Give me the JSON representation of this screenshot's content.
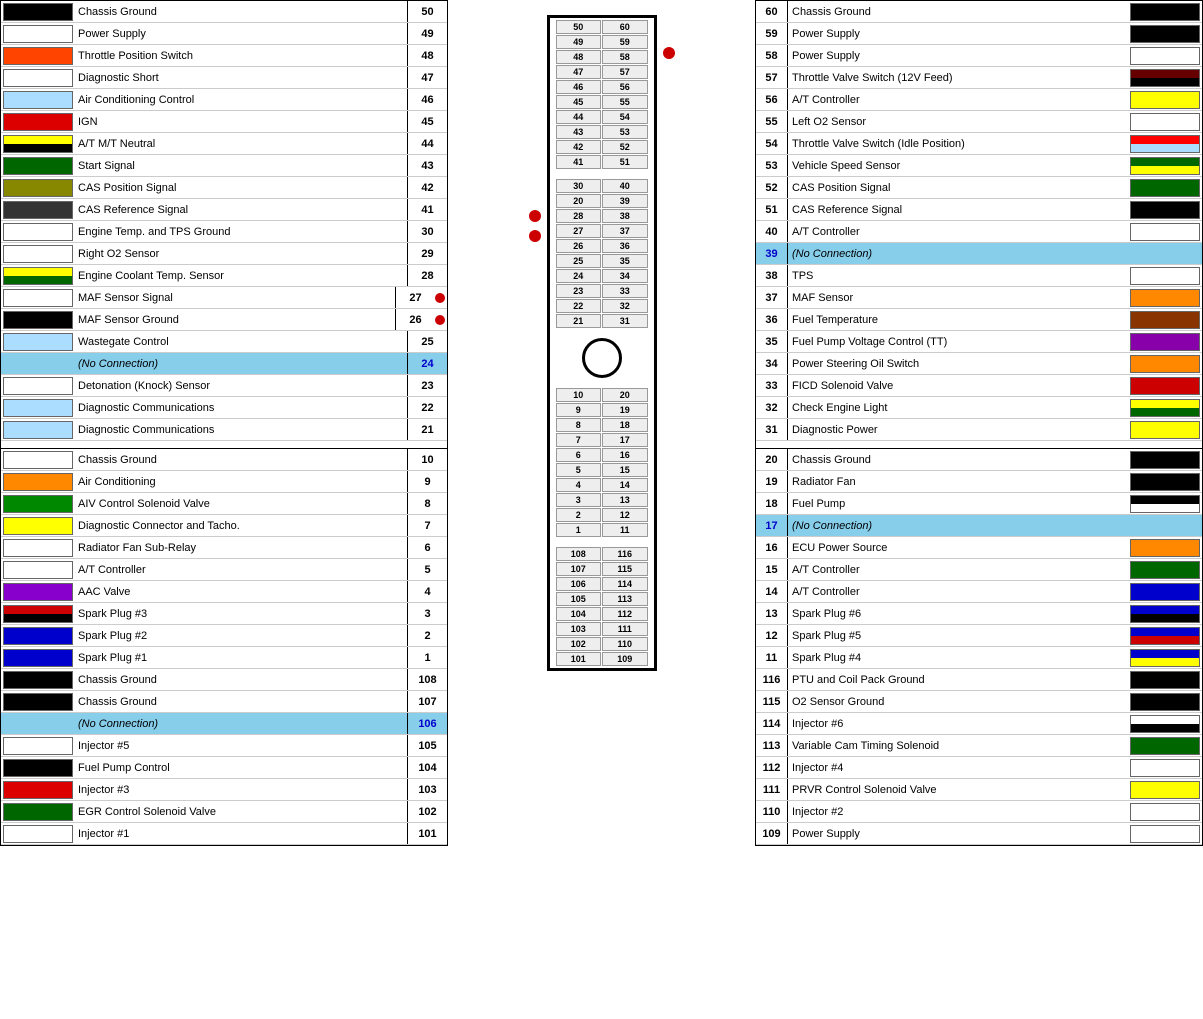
{
  "left": {
    "rows_top": [
      {
        "num": 50,
        "label": "Chassis Ground",
        "color": "#000000",
        "color2": null
      },
      {
        "num": 49,
        "label": "Power Supply",
        "color": "#ffffff",
        "color2": null
      },
      {
        "num": 48,
        "label": "Throttle Position Switch",
        "color": "#ff4400",
        "color2": null,
        "stripe": "#000000"
      },
      {
        "num": 47,
        "label": "Diagnostic Short",
        "color": "#ffffff",
        "color2": null
      },
      {
        "num": 46,
        "label": "Air Conditioning Control",
        "color": "#aaddff",
        "color2": null
      },
      {
        "num": 45,
        "label": "IGN",
        "color": "#dd0000",
        "color2": null
      },
      {
        "num": 44,
        "label": "A/T M/T Neutral",
        "color": "#ffff00",
        "color2": "#000000"
      },
      {
        "num": 43,
        "label": "Start Signal",
        "color": "#006600",
        "color2": null
      },
      {
        "num": 42,
        "label": "CAS Position Signal",
        "color": "#888800",
        "color2": null
      },
      {
        "num": 41,
        "label": "CAS Reference Signal",
        "color": "#333333",
        "color2": null
      },
      {
        "num": 30,
        "label": "Engine Temp. and TPS Ground",
        "color": "#ffffff",
        "color2": null
      },
      {
        "num": 29,
        "label": "Right O2 Sensor",
        "color": "#ffffff",
        "color2": null
      },
      {
        "num": 28,
        "label": "Engine Coolant Temp. Sensor",
        "color": "#ffff00",
        "color2": "#006600"
      },
      {
        "num": 27,
        "label": "MAF Sensor Signal",
        "color": "#ffffff",
        "color2": null,
        "dot": true
      },
      {
        "num": 26,
        "label": "MAF Sensor Ground",
        "color": "#000000",
        "color2": null,
        "dot": true
      },
      {
        "num": 25,
        "label": "Wastegate Control",
        "color": "#aaddff",
        "color2": null
      },
      {
        "num": 24,
        "label": "(No Connection)",
        "color": null,
        "color2": null,
        "no_conn": true
      },
      {
        "num": 23,
        "label": "Detonation (Knock) Sensor",
        "color": "#ffffff",
        "color2": null
      },
      {
        "num": 22,
        "label": "Diagnostic Communications",
        "color": "#aaddff",
        "color2": null
      },
      {
        "num": 21,
        "label": "Diagnostic Communications",
        "color": "#aaddff",
        "color2": null
      }
    ],
    "rows_bottom": [
      {
        "num": 10,
        "label": "Chassis Ground",
        "color": "#ffffff",
        "color2": null
      },
      {
        "num": 9,
        "label": "Air Conditioning",
        "color": "#ff8800",
        "color2": null
      },
      {
        "num": 8,
        "label": "AIV Control Solenoid Valve",
        "color": "#008800",
        "color2": null
      },
      {
        "num": 7,
        "label": "Diagnostic Connector and Tacho.",
        "color": "#ffff00",
        "color2": null
      },
      {
        "num": 6,
        "label": "Radiator Fan Sub-Relay",
        "color": "#ffffff",
        "color2": null
      },
      {
        "num": 5,
        "label": "A/T Controller",
        "color": "#ffffff",
        "color2": null
      },
      {
        "num": 4,
        "label": "AAC Valve",
        "color": "#8800cc",
        "color2": null
      },
      {
        "num": 3,
        "label": "Spark Plug #3",
        "color": "#cc0000",
        "color2": "#000000"
      },
      {
        "num": 2,
        "label": "Spark Plug #2",
        "color": "#0000cc",
        "color2": null
      },
      {
        "num": 1,
        "label": "Spark Plug #1",
        "color": "#0000cc",
        "color2": null
      },
      {
        "num": 108,
        "label": "Chassis Ground",
        "color": "#000000",
        "color2": null
      },
      {
        "num": 107,
        "label": "Chassis Ground",
        "color": "#000000",
        "color2": null
      },
      {
        "num": 106,
        "label": "(No Connection)",
        "color": null,
        "color2": null,
        "no_conn": true
      },
      {
        "num": 105,
        "label": "Injector #5",
        "color": "#ffffff",
        "color2": null
      },
      {
        "num": 104,
        "label": "Fuel Pump Control",
        "color": "#000000",
        "color2": null
      },
      {
        "num": 103,
        "label": "Injector #3",
        "color": "#dd0000",
        "color2": null
      },
      {
        "num": 102,
        "label": "EGR Control Solenoid Valve",
        "color": "#006600",
        "color2": null
      },
      {
        "num": 101,
        "label": "Injector #1",
        "color": "#ffffff",
        "color2": null
      }
    ]
  },
  "right": {
    "rows_top": [
      {
        "num": 60,
        "label": "Chassis Ground",
        "color": "#000000",
        "color2": null
      },
      {
        "num": 59,
        "label": "Power Supply",
        "color": "#000000",
        "color2": null
      },
      {
        "num": 58,
        "label": "Power Supply",
        "color": "#ffffff",
        "color2": null
      },
      {
        "num": 57,
        "label": "Throttle Valve Switch (12V Feed)",
        "color": "#660000",
        "color2": "#000000"
      },
      {
        "num": 56,
        "label": "A/T Controller",
        "color": "#ffff00",
        "color2": null
      },
      {
        "num": 55,
        "label": "Left O2 Sensor",
        "color": "#ffffff",
        "color2": null
      },
      {
        "num": 54,
        "label": "Throttle Valve Switch (Idle Position)",
        "color": "#ff0000",
        "color2": "#aaddff"
      },
      {
        "num": 53,
        "label": "Vehicle Speed Sensor",
        "color": "#006600",
        "color2": "#ffff00"
      },
      {
        "num": 52,
        "label": "CAS Position Signal",
        "color": "#006600",
        "color2": null
      },
      {
        "num": 51,
        "label": "CAS Reference Signal",
        "color": "#000000",
        "color2": null
      },
      {
        "num": 40,
        "label": "A/T Controller",
        "color": "#ffffff",
        "color2": null
      },
      {
        "num": 39,
        "label": "(No Connection)",
        "color": null,
        "color2": null,
        "no_conn": true
      },
      {
        "num": 38,
        "label": "TPS",
        "color": "#ffffff",
        "color2": null
      },
      {
        "num": 37,
        "label": "MAF Sensor",
        "color": "#ff8800",
        "color2": null
      },
      {
        "num": 36,
        "label": "Fuel Temperature",
        "color": "#883300",
        "color2": null
      },
      {
        "num": 35,
        "label": "Fuel Pump Voltage Control (TT)",
        "color": "#8800aa",
        "color2": null
      },
      {
        "num": 34,
        "label": "Power Steering Oil Switch",
        "color": "#ff8800",
        "color2": null
      },
      {
        "num": 33,
        "label": "FICD Solenoid Valve",
        "color": "#cc0000",
        "color2": null
      },
      {
        "num": 32,
        "label": "Check Engine Light",
        "color": "#ffff00",
        "color2": "#006600"
      },
      {
        "num": 31,
        "label": "Diagnostic Power",
        "color": "#ffff00",
        "color2": null
      }
    ],
    "rows_bottom": [
      {
        "num": 20,
        "label": "Chassis Ground",
        "color": "#000000",
        "color2": null
      },
      {
        "num": 19,
        "label": "Radiator Fan",
        "color": "#000000",
        "color2": null
      },
      {
        "num": 18,
        "label": "Fuel Pump",
        "color": "#000000",
        "color2": "#ffffff"
      },
      {
        "num": 17,
        "label": "(No Connection)",
        "color": null,
        "color2": null,
        "no_conn": true
      },
      {
        "num": 16,
        "label": "ECU Power Source",
        "color": "#ff8800",
        "color2": null
      },
      {
        "num": 15,
        "label": "A/T Controller",
        "color": "#006600",
        "color2": null
      },
      {
        "num": 14,
        "label": "A/T Controller",
        "color": "#0000cc",
        "color2": null
      },
      {
        "num": 13,
        "label": "Spark Plug #6",
        "color": "#0000cc",
        "color2": "#000000"
      },
      {
        "num": 12,
        "label": "Spark Plug #5",
        "color": "#0000cc",
        "color2": "#cc0000"
      },
      {
        "num": 11,
        "label": "Spark Plug #4",
        "color": "#0000cc",
        "color2": "#ffff00"
      },
      {
        "num": 116,
        "label": "PTU and Coil Pack Ground",
        "color": "#000000",
        "color2": null
      },
      {
        "num": 115,
        "label": "O2 Sensor Ground",
        "color": "#000000",
        "color2": null
      },
      {
        "num": 114,
        "label": "Injector #6",
        "color": "#ffffff",
        "color2": "#000000"
      },
      {
        "num": 113,
        "label": "Variable Cam Timing Solenoid",
        "color": "#006600",
        "color2": null
      },
      {
        "num": 112,
        "label": "Injector #4",
        "color": "#ffffff",
        "color2": null
      },
      {
        "num": 111,
        "label": "PRVR Control Solenoid Valve",
        "color": "#ffff00",
        "color2": null
      },
      {
        "num": 110,
        "label": "Injector #2",
        "color": "#ffffff",
        "color2": null
      },
      {
        "num": 109,
        "label": "Power Supply",
        "color": "#ffffff",
        "color2": null
      }
    ]
  },
  "connector": {
    "top_pairs": [
      [
        50,
        60
      ],
      [
        49,
        59
      ],
      [
        48,
        58
      ],
      [
        47,
        57
      ],
      [
        46,
        56
      ],
      [
        45,
        55
      ],
      [
        44,
        54
      ],
      [
        43,
        53
      ],
      [
        42,
        52
      ],
      [
        41,
        51
      ]
    ],
    "mid_pairs": [
      [
        30,
        40
      ],
      [
        20,
        39
      ],
      [
        28,
        38
      ],
      [
        27,
        37
      ],
      [
        26,
        36
      ],
      [
        25,
        35
      ],
      [
        24,
        34
      ],
      [
        23,
        33
      ],
      [
        22,
        32
      ],
      [
        21,
        31
      ]
    ],
    "bot_pairs_1": [
      [
        10,
        20
      ],
      [
        9,
        19
      ],
      [
        8,
        18
      ],
      [
        7,
        17
      ],
      [
        6,
        16
      ],
      [
        5,
        15
      ],
      [
        4,
        14
      ],
      [
        3,
        13
      ],
      [
        2,
        12
      ],
      [
        1,
        11
      ]
    ],
    "bot_pairs_2": [
      [
        108,
        116
      ],
      [
        107,
        115
      ],
      [
        106,
        114
      ],
      [
        105,
        113
      ],
      [
        104,
        112
      ],
      [
        103,
        111
      ],
      [
        102,
        110
      ],
      [
        101,
        109
      ]
    ]
  }
}
